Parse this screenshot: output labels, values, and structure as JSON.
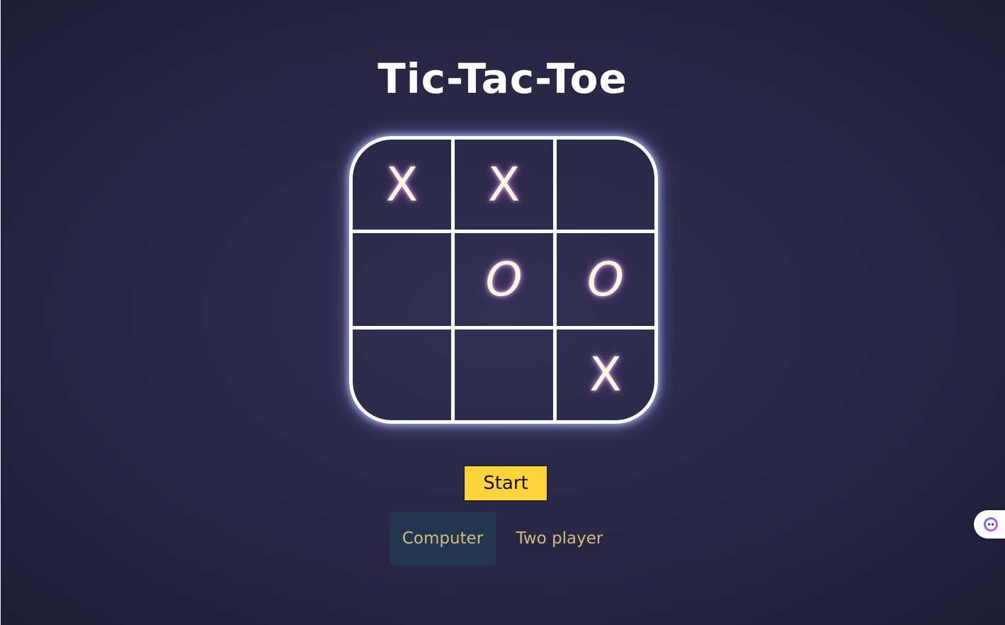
{
  "title": "Tic-Tac-Toe",
  "board": {
    "cells": [
      "X",
      "X",
      "",
      "",
      "O",
      "O",
      "",
      "",
      "X"
    ]
  },
  "controls": {
    "start_label": "Start"
  },
  "modes": [
    {
      "label": "Computer",
      "selected": true
    },
    {
      "label": "Two player",
      "selected": false
    }
  ],
  "assistant": {
    "icon": "assistant-face-icon"
  },
  "colors": {
    "start_button": "#ffd43b",
    "mode_text": "#d6ba7c",
    "selected_mode_bg": "#223650",
    "board_line": "#ffffff"
  }
}
